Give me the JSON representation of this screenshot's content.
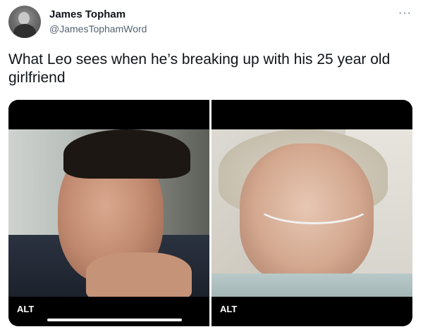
{
  "author": {
    "display_name": "James Topham",
    "handle": "@JamesTophamWord"
  },
  "more_menu": "···",
  "tweet": {
    "text": "What Leo sees when he’s breaking up with his 25 year old girlfriend"
  },
  "media": {
    "items": [
      {
        "alt_label": "ALT",
        "icon": "man-photo"
      },
      {
        "alt_label": "ALT",
        "icon": "elderly-woman-photo"
      }
    ]
  }
}
